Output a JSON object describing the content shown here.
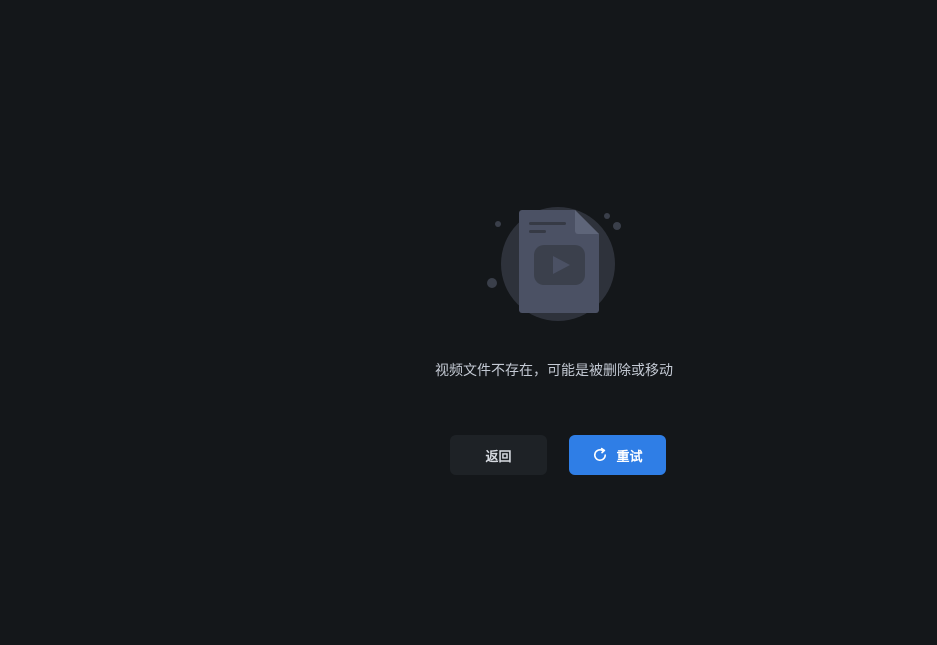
{
  "error": {
    "message": "视频文件不存在，可能是被删除或移动",
    "illustration_icon": "missing-video-file-icon"
  },
  "actions": {
    "back_label": "返回",
    "retry_label": "重试",
    "retry_icon": "refresh-icon"
  },
  "colors": {
    "background": "#14171a",
    "primary": "#2f7ee6",
    "secondary_button": "#1e2226",
    "illustration": "#4b5164"
  }
}
